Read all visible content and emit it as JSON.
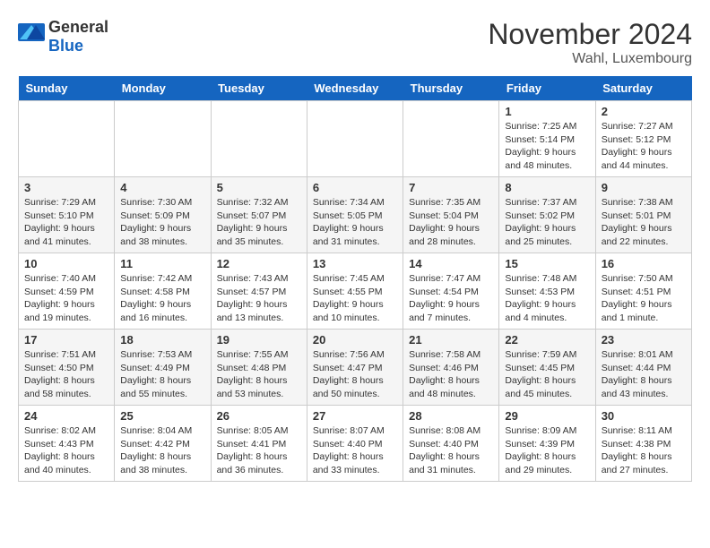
{
  "header": {
    "logo_general": "General",
    "logo_blue": "Blue",
    "month": "November 2024",
    "location": "Wahl, Luxembourg"
  },
  "days_of_week": [
    "Sunday",
    "Monday",
    "Tuesday",
    "Wednesday",
    "Thursday",
    "Friday",
    "Saturday"
  ],
  "weeks": [
    [
      {
        "day": "",
        "info": ""
      },
      {
        "day": "",
        "info": ""
      },
      {
        "day": "",
        "info": ""
      },
      {
        "day": "",
        "info": ""
      },
      {
        "day": "",
        "info": ""
      },
      {
        "day": "1",
        "info": "Sunrise: 7:25 AM\nSunset: 5:14 PM\nDaylight: 9 hours\nand 48 minutes."
      },
      {
        "day": "2",
        "info": "Sunrise: 7:27 AM\nSunset: 5:12 PM\nDaylight: 9 hours\nand 44 minutes."
      }
    ],
    [
      {
        "day": "3",
        "info": "Sunrise: 7:29 AM\nSunset: 5:10 PM\nDaylight: 9 hours\nand 41 minutes."
      },
      {
        "day": "4",
        "info": "Sunrise: 7:30 AM\nSunset: 5:09 PM\nDaylight: 9 hours\nand 38 minutes."
      },
      {
        "day": "5",
        "info": "Sunrise: 7:32 AM\nSunset: 5:07 PM\nDaylight: 9 hours\nand 35 minutes."
      },
      {
        "day": "6",
        "info": "Sunrise: 7:34 AM\nSunset: 5:05 PM\nDaylight: 9 hours\nand 31 minutes."
      },
      {
        "day": "7",
        "info": "Sunrise: 7:35 AM\nSunset: 5:04 PM\nDaylight: 9 hours\nand 28 minutes."
      },
      {
        "day": "8",
        "info": "Sunrise: 7:37 AM\nSunset: 5:02 PM\nDaylight: 9 hours\nand 25 minutes."
      },
      {
        "day": "9",
        "info": "Sunrise: 7:38 AM\nSunset: 5:01 PM\nDaylight: 9 hours\nand 22 minutes."
      }
    ],
    [
      {
        "day": "10",
        "info": "Sunrise: 7:40 AM\nSunset: 4:59 PM\nDaylight: 9 hours\nand 19 minutes."
      },
      {
        "day": "11",
        "info": "Sunrise: 7:42 AM\nSunset: 4:58 PM\nDaylight: 9 hours\nand 16 minutes."
      },
      {
        "day": "12",
        "info": "Sunrise: 7:43 AM\nSunset: 4:57 PM\nDaylight: 9 hours\nand 13 minutes."
      },
      {
        "day": "13",
        "info": "Sunrise: 7:45 AM\nSunset: 4:55 PM\nDaylight: 9 hours\nand 10 minutes."
      },
      {
        "day": "14",
        "info": "Sunrise: 7:47 AM\nSunset: 4:54 PM\nDaylight: 9 hours\nand 7 minutes."
      },
      {
        "day": "15",
        "info": "Sunrise: 7:48 AM\nSunset: 4:53 PM\nDaylight: 9 hours\nand 4 minutes."
      },
      {
        "day": "16",
        "info": "Sunrise: 7:50 AM\nSunset: 4:51 PM\nDaylight: 9 hours\nand 1 minute."
      }
    ],
    [
      {
        "day": "17",
        "info": "Sunrise: 7:51 AM\nSunset: 4:50 PM\nDaylight: 8 hours\nand 58 minutes."
      },
      {
        "day": "18",
        "info": "Sunrise: 7:53 AM\nSunset: 4:49 PM\nDaylight: 8 hours\nand 55 minutes."
      },
      {
        "day": "19",
        "info": "Sunrise: 7:55 AM\nSunset: 4:48 PM\nDaylight: 8 hours\nand 53 minutes."
      },
      {
        "day": "20",
        "info": "Sunrise: 7:56 AM\nSunset: 4:47 PM\nDaylight: 8 hours\nand 50 minutes."
      },
      {
        "day": "21",
        "info": "Sunrise: 7:58 AM\nSunset: 4:46 PM\nDaylight: 8 hours\nand 48 minutes."
      },
      {
        "day": "22",
        "info": "Sunrise: 7:59 AM\nSunset: 4:45 PM\nDaylight: 8 hours\nand 45 minutes."
      },
      {
        "day": "23",
        "info": "Sunrise: 8:01 AM\nSunset: 4:44 PM\nDaylight: 8 hours\nand 43 minutes."
      }
    ],
    [
      {
        "day": "24",
        "info": "Sunrise: 8:02 AM\nSunset: 4:43 PM\nDaylight: 8 hours\nand 40 minutes."
      },
      {
        "day": "25",
        "info": "Sunrise: 8:04 AM\nSunset: 4:42 PM\nDaylight: 8 hours\nand 38 minutes."
      },
      {
        "day": "26",
        "info": "Sunrise: 8:05 AM\nSunset: 4:41 PM\nDaylight: 8 hours\nand 36 minutes."
      },
      {
        "day": "27",
        "info": "Sunrise: 8:07 AM\nSunset: 4:40 PM\nDaylight: 8 hours\nand 33 minutes."
      },
      {
        "day": "28",
        "info": "Sunrise: 8:08 AM\nSunset: 4:40 PM\nDaylight: 8 hours\nand 31 minutes."
      },
      {
        "day": "29",
        "info": "Sunrise: 8:09 AM\nSunset: 4:39 PM\nDaylight: 8 hours\nand 29 minutes."
      },
      {
        "day": "30",
        "info": "Sunrise: 8:11 AM\nSunset: 4:38 PM\nDaylight: 8 hours\nand 27 minutes."
      }
    ]
  ]
}
